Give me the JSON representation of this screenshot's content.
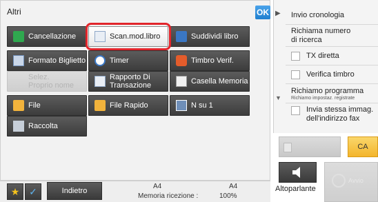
{
  "panel": {
    "title": "Altri",
    "ok_label": "OK"
  },
  "buttons": {
    "cancellazione": "Cancellazione",
    "scan_mod_libro": "Scan.mod.libro",
    "suddividi_libro": "Suddividi libro",
    "formato_biglietto": "Formato Biglietto",
    "timer": "Timer",
    "timbro_verif": "Timbro Verif.",
    "selez_proprio_nome_1": "Selez.",
    "selez_proprio_nome_2": "Proprio nome",
    "rapporto_1": "Rapporto  Di",
    "rapporto_2": "Transazione",
    "casella_memoria": "Casella Memoria",
    "file": "File",
    "file_rapido": "File Rapido",
    "n_su_1": "N su 1",
    "raccolta": "Raccolta"
  },
  "right_list": {
    "invio_cronologia": "Invio cronologia",
    "richiama_numero_1": "Richiama numero",
    "richiama_numero_2": "di ricerca",
    "tx_diretta": "TX diretta",
    "verifica_timbro": "Verifica timbro",
    "richiamo_programma": "Richiamo programma",
    "richiamo_programma_sub": "Richiamo impostaz. registrate",
    "invia_stessa_1": "Invia stessa immag.",
    "invia_stessa_2": "dell'indirizzo fax"
  },
  "controls": {
    "ca_label": "CA",
    "speaker_label": "Altoparlante",
    "start_label": "Avvio"
  },
  "statusbar": {
    "back_label": "Indietro",
    "paper_left": "A4",
    "paper_right": "A4",
    "memory_label": "Memoria ricezione :",
    "memory_value": "100%"
  },
  "colors": {
    "highlight": "#e2252b",
    "ca": "#f3b52c",
    "ok": "#1f7fcf"
  }
}
